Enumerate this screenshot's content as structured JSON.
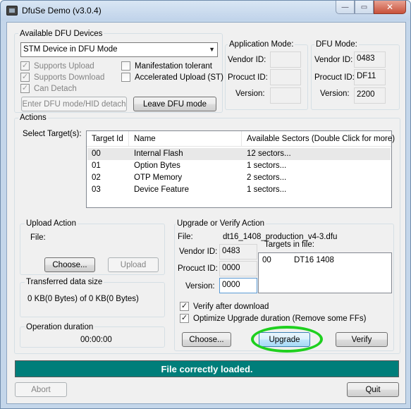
{
  "window": {
    "title": "DfuSe Demo (v3.0.4)"
  },
  "caption": {
    "minimize": "—",
    "maximize": "▭",
    "close": "✕"
  },
  "devices": {
    "group_label": "Available DFU Devices",
    "selected": "STM Device in DFU Mode",
    "checkboxes": [
      {
        "label": "Supports Upload",
        "checked": true
      },
      {
        "label": "Supports Download",
        "checked": true
      },
      {
        "label": "Can Detach",
        "checked": true
      },
      {
        "label": "Manifestation tolerant",
        "checked": false
      },
      {
        "label": "Accelerated Upload (ST)",
        "checked": false
      }
    ],
    "enter_dfu_button": "Enter DFU mode/HID detach",
    "leave_dfu_button": "Leave DFU mode"
  },
  "app_mode": {
    "group_label": "Application Mode:",
    "vendor_label": "Vendor ID:",
    "vendor_value": "",
    "product_label": "Procuct ID:",
    "product_value": "",
    "version_label": "Version:",
    "version_value": ""
  },
  "dfu_mode": {
    "group_label": "DFU Mode:",
    "vendor_label": "Vendor ID:",
    "vendor_value": "0483",
    "product_label": "Procuct ID:",
    "product_value": "DF11",
    "version_label": "Version:",
    "version_value": "2200"
  },
  "actions": {
    "group_label": "Actions",
    "select_targets_label": "Select Target(s):",
    "columns": [
      "Target Id",
      "Name",
      "Available Sectors (Double Click for more)"
    ],
    "rows": [
      [
        "00",
        "Internal Flash",
        "12 sectors..."
      ],
      [
        "01",
        "Option Bytes",
        "1 sectors..."
      ],
      [
        "02",
        "OTP Memory",
        "2 sectors..."
      ],
      [
        "03",
        "Device Feature",
        "1 sectors..."
      ]
    ]
  },
  "upload": {
    "group_label": "Upload Action",
    "file_label": "File:",
    "choose_button": "Choose...",
    "upload_button": "Upload"
  },
  "transferred": {
    "group_label": "Transferred data size",
    "text": "0 KB(0 Bytes) of 0 KB(0 Bytes)"
  },
  "duration": {
    "group_label": "Operation duration",
    "text": "00:00:00"
  },
  "upgrade": {
    "group_label": "Upgrade or Verify Action",
    "file_label": "File:",
    "file_value": "dt16_1408_production_v4-3.dfu",
    "vendor_label": "Vendor ID:",
    "vendor_value": "0483",
    "product_label": "Procuct ID:",
    "product_value": "0000",
    "version_label": "Version:",
    "version_value": "0000",
    "targets_label": "Targets in file:",
    "targets": [
      {
        "id": "00",
        "name": "DT16 1408"
      }
    ],
    "verify_checkbox": {
      "label": "Verify after download",
      "checked": true
    },
    "optimize_checkbox": {
      "label": "Optimize Upgrade duration (Remove some FFs)",
      "checked": true
    },
    "choose_button": "Choose...",
    "upgrade_button": "Upgrade",
    "verify_button": "Verify",
    "highlight_color": "#1fd01f"
  },
  "status": {
    "text": "File correctly loaded.",
    "color": "#007e7a"
  },
  "footer": {
    "abort_button": "Abort",
    "quit_button": "Quit"
  }
}
